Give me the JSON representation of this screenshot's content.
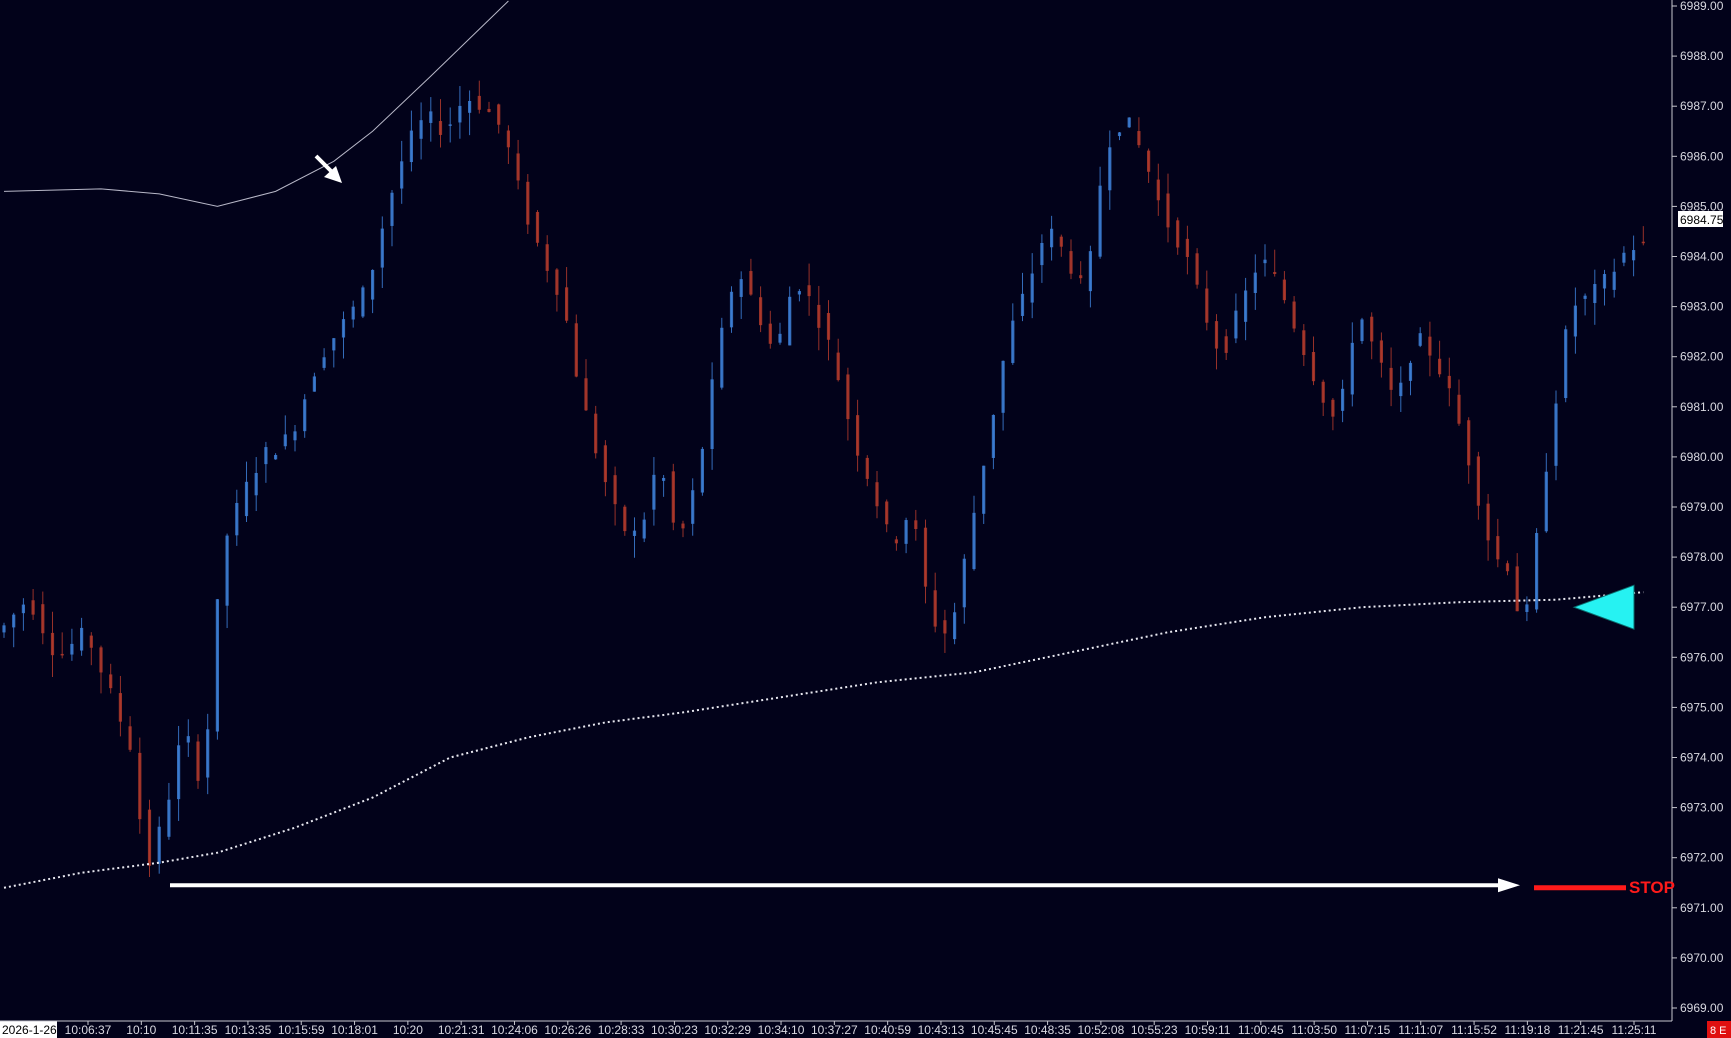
{
  "chart_data": {
    "type": "candlestick",
    "y_axis": {
      "position": "right",
      "range": [
        6969.0,
        6989.0
      ],
      "ticks": [
        "6969.00",
        "6970.00",
        "6971.00",
        "6972.00",
        "6973.00",
        "6974.00",
        "6975.00",
        "6976.00",
        "6977.00",
        "6978.00",
        "6979.00",
        "6980.00",
        "6981.00",
        "6982.00",
        "6983.00",
        "6984.00",
        "6985.00",
        "6986.00",
        "6987.00",
        "6988.00",
        "6989.00"
      ],
      "current_price_label": "6984.75",
      "current_price": 6984.75
    },
    "x_axis": {
      "date_label": "2026-1-26",
      "corner_label": "8 E",
      "tick_labels": [
        "10:06:37",
        "10:10",
        "10:11:35",
        "10:13:35",
        "10:15:59",
        "10:18:01",
        "10:20",
        "10:21:31",
        "10:24:06",
        "10:26:26",
        "10:28:33",
        "10:30:23",
        "10:32:29",
        "10:34:10",
        "10:37:27",
        "10:40:59",
        "10:43:13",
        "10:45:45",
        "10:48:35",
        "10:52:08",
        "10:55:23",
        "10:59:11",
        "11:00:45",
        "11:03:50",
        "11:07:15",
        "11:11:07",
        "11:15:52",
        "11:19:18",
        "11:21:45",
        "11:25:11"
      ]
    },
    "price_path": [
      [
        0,
        6976.5
      ],
      [
        3,
        6977.2
      ],
      [
        6,
        6976.0
      ],
      [
        9,
        6976.5
      ],
      [
        12,
        6975.0
      ],
      [
        14,
        6974.0
      ],
      [
        15,
        6971.6
      ],
      [
        17,
        6972.8
      ],
      [
        19,
        6974.6
      ],
      [
        21,
        6973.4
      ],
      [
        23,
        6978.2
      ],
      [
        25,
        6979.2
      ],
      [
        27,
        6980.0
      ],
      [
        30,
        6980.4
      ],
      [
        33,
        6982.0
      ],
      [
        36,
        6982.8
      ],
      [
        38,
        6983.4
      ],
      [
        40,
        6985.0
      ],
      [
        42,
        6986.2
      ],
      [
        44,
        6986.8
      ],
      [
        46,
        6986.5
      ],
      [
        48,
        6987.2
      ],
      [
        50,
        6987.0
      ],
      [
        52,
        6986.5
      ],
      [
        54,
        6985.0
      ],
      [
        56,
        6984.0
      ],
      [
        58,
        6983.2
      ],
      [
        60,
        6981.2
      ],
      [
        62,
        6979.8
      ],
      [
        64,
        6978.6
      ],
      [
        66,
        6978.4
      ],
      [
        68,
        6980.0
      ],
      [
        70,
        6978.2
      ],
      [
        72,
        6979.6
      ],
      [
        74,
        6982.0
      ],
      [
        76,
        6983.8
      ],
      [
        78,
        6983.0
      ],
      [
        80,
        6982.0
      ],
      [
        82,
        6983.6
      ],
      [
        84,
        6983.0
      ],
      [
        86,
        6982.0
      ],
      [
        88,
        6980.4
      ],
      [
        90,
        6979.4
      ],
      [
        92,
        6978.2
      ],
      [
        94,
        6979.0
      ],
      [
        96,
        6976.8
      ],
      [
        98,
        6976.4
      ],
      [
        100,
        6978.4
      ],
      [
        102,
        6980.4
      ],
      [
        104,
        6982.4
      ],
      [
        106,
        6983.4
      ],
      [
        108,
        6984.6
      ],
      [
        110,
        6984.0
      ],
      [
        112,
        6983.2
      ],
      [
        114,
        6986.2
      ],
      [
        116,
        6986.8
      ],
      [
        118,
        6986.0
      ],
      [
        120,
        6984.8
      ],
      [
        122,
        6984.2
      ],
      [
        124,
        6983.0
      ],
      [
        126,
        6982.0
      ],
      [
        128,
        6983.0
      ],
      [
        130,
        6984.0
      ],
      [
        132,
        6983.4
      ],
      [
        134,
        6982.4
      ],
      [
        136,
        6981.4
      ],
      [
        138,
        6980.6
      ],
      [
        140,
        6983.0
      ],
      [
        142,
        6982.0
      ],
      [
        144,
        6981.0
      ],
      [
        146,
        6982.4
      ],
      [
        148,
        6982.0
      ],
      [
        150,
        6981.0
      ],
      [
        152,
        6979.6
      ],
      [
        154,
        6978.0
      ],
      [
        156,
        6977.8
      ],
      [
        157,
        6976.2
      ],
      [
        158,
        6977.6
      ],
      [
        160,
        6980.6
      ],
      [
        162,
        6983.0
      ],
      [
        164,
        6983.2
      ],
      [
        166,
        6983.6
      ],
      [
        168,
        6984.2
      ]
    ],
    "candle_count": 170,
    "moving_average_dotted": [
      [
        0,
        6971.4
      ],
      [
        8,
        6971.7
      ],
      [
        16,
        6971.9
      ],
      [
        22,
        6972.1
      ],
      [
        30,
        6972.6
      ],
      [
        38,
        6973.2
      ],
      [
        46,
        6974.0
      ],
      [
        54,
        6974.4
      ],
      [
        62,
        6974.7
      ],
      [
        70,
        6974.9
      ],
      [
        80,
        6975.2
      ],
      [
        90,
        6975.5
      ],
      [
        100,
        6975.7
      ],
      [
        110,
        6976.1
      ],
      [
        120,
        6976.5
      ],
      [
        130,
        6976.8
      ],
      [
        140,
        6977.0
      ],
      [
        150,
        6977.1
      ],
      [
        160,
        6977.15
      ],
      [
        169,
        6977.3
      ]
    ],
    "upper_band_solid": [
      [
        0,
        6985.3
      ],
      [
        10,
        6985.35
      ],
      [
        16,
        6985.25
      ],
      [
        22,
        6985.0
      ],
      [
        28,
        6985.3
      ],
      [
        34,
        6985.9
      ],
      [
        38,
        6986.5
      ],
      [
        44,
        6987.6
      ],
      [
        52,
        6989.1
      ]
    ],
    "annotations": {
      "stop_label": "STOP",
      "stop_level": 6971.4,
      "horizontal_arrow_level": 6971.45,
      "entry_triangle_level": 6977.0,
      "entry_triangle_color": "#26f2f2",
      "stop_color": "#ff1a1a"
    },
    "colors": {
      "background": "#02021a",
      "up_candle": "#3d7fd6",
      "down_candle": "#b23a2c",
      "axis_text": "#d8d8e0",
      "axis_line": "#c8c8d0",
      "corner_badge": "#e01010"
    }
  }
}
